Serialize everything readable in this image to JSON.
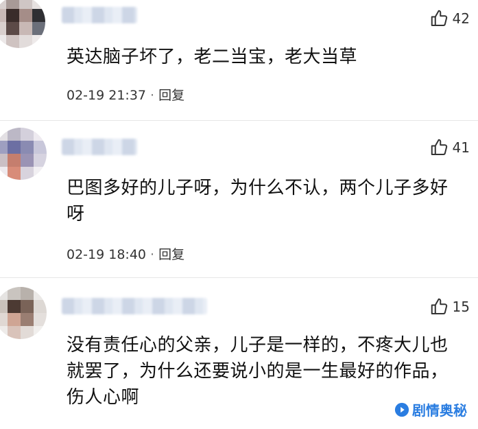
{
  "comments": [
    {
      "likes": "42",
      "text": "英达脑子坏了，老二当宝，老大当草",
      "time": "02-19 21:37",
      "reply_label": "回复"
    },
    {
      "likes": "41",
      "text": "巴图多好的儿子呀，为什么不认，两个儿子多好呀",
      "time": "02-19 18:40",
      "reply_label": "回复"
    },
    {
      "likes": "15",
      "text": "没有责任心的父亲，儿子是一样的，不疼大儿也就罢了，为什么还要说小的是一生最好的作品，伤人心啊",
      "time": "",
      "reply_label": ""
    }
  ],
  "icons": {
    "like": "thumbs-up-icon",
    "watermark": "play-logo-icon"
  },
  "watermark_text": "剧情奥秘",
  "colors": {
    "watermark": "#2a7de1",
    "text": "#111111",
    "meta": "#333333"
  }
}
